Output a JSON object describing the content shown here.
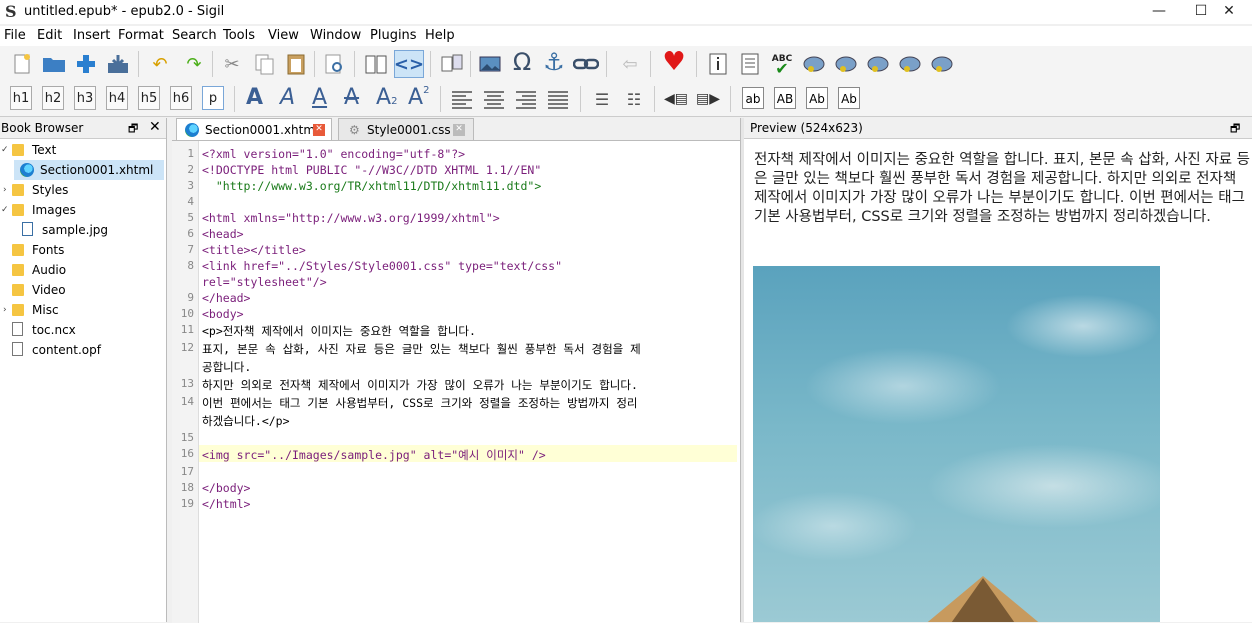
{
  "window": {
    "title": "untitled.epub* - epub2.0 - Sigil",
    "app_icon": "S",
    "controls": [
      "—",
      "☐",
      "✕"
    ]
  },
  "menu": [
    "File",
    "Edit",
    "Insert",
    "Format",
    "Search",
    "Tools",
    "View",
    "Window",
    "Plugins",
    "Help"
  ],
  "toolbar2": {
    "headings": [
      "h1",
      "h2",
      "h3",
      "h4",
      "h5",
      "h6",
      "p"
    ],
    "case": [
      "ab",
      "AB",
      "Ab",
      "Ab"
    ],
    "spellcheck_label": "ABC"
  },
  "book_browser": {
    "title": "Book Browser",
    "items": [
      {
        "label": "Text",
        "type": "folder"
      },
      {
        "label": "Section0001.xhtml",
        "type": "xhtml"
      },
      {
        "label": "Styles",
        "type": "folder"
      },
      {
        "label": "Images",
        "type": "folder"
      },
      {
        "label": "sample.jpg",
        "type": "image"
      },
      {
        "label": "Fonts",
        "type": "folder"
      },
      {
        "label": "Audio",
        "type": "folder"
      },
      {
        "label": "Video",
        "type": "folder"
      },
      {
        "label": "Misc",
        "type": "folder"
      },
      {
        "label": "toc.ncx",
        "type": "file"
      },
      {
        "label": "content.opf",
        "type": "file"
      }
    ]
  },
  "tabs": [
    {
      "label": "Section0001.xhtml",
      "active": true
    },
    {
      "label": "Style0001.css",
      "active": false
    }
  ],
  "editor": {
    "line_numbers": [
      "1",
      "2",
      "3",
      "4",
      "5",
      "6",
      "7",
      "8",
      "9",
      "10",
      "11",
      "12",
      "13",
      "14",
      "15",
      "16",
      "17",
      "18",
      "19"
    ],
    "lines": [
      "<?xml version=\"1.0\" encoding=\"utf-8\"?>",
      "<!DOCTYPE html PUBLIC \"-//W3C//DTD XHTML 1.1//EN\"",
      "  \"http://www.w3.org/TR/xhtml11/DTD/xhtml11.dtd\">",
      "",
      "<html xmlns=\"http://www.w3.org/1999/xhtml\">",
      "<head>",
      "<title></title>",
      "<link href=\"../Styles/Style0001.css\" type=\"text/css\"",
      "rel=\"stylesheet\"/>",
      "</head>",
      "<body>",
      "<p>전자책 제작에서 이미지는 중요한 역할을 합니다.",
      "표지, 본문 속 삽화, 사진 자료 등은 글만 있는 책보다 훨씬 풍부한 독서 경험을 제",
      "공합니다.",
      "하지만 의외로 전자책 제작에서 이미지가 가장 많이 오류가 나는 부분이기도 합니다.",
      "이번 편에서는 태그 기본 사용법부터, CSS로 크기와 정렬을 조정하는 방법까지 정리",
      "하겠습니다.</p>",
      "",
      "<img src=\"../Images/sample.jpg\" alt=\"예시 이미지\" />",
      "",
      "</body>",
      "</html>"
    ]
  },
  "preview": {
    "title": "Preview (524x623)",
    "paragraph": "전자책 제작에서 이미지는 중요한 역할을 합니다. 표지, 본문 속 삽화, 사진 자료 등은 글만 있는 책보다 훨씬 풍부한 독서 경험을 제공합니다. 하지만 의외로 전자책 제작에서 이미지가 가장 많이 오류가 나는 부분이기도 합니다. 이번 편에서는 태그 기본 사용법부터, CSS로 크기와 정렬을 조정하는 방법까지 정리하겠습니다."
  }
}
